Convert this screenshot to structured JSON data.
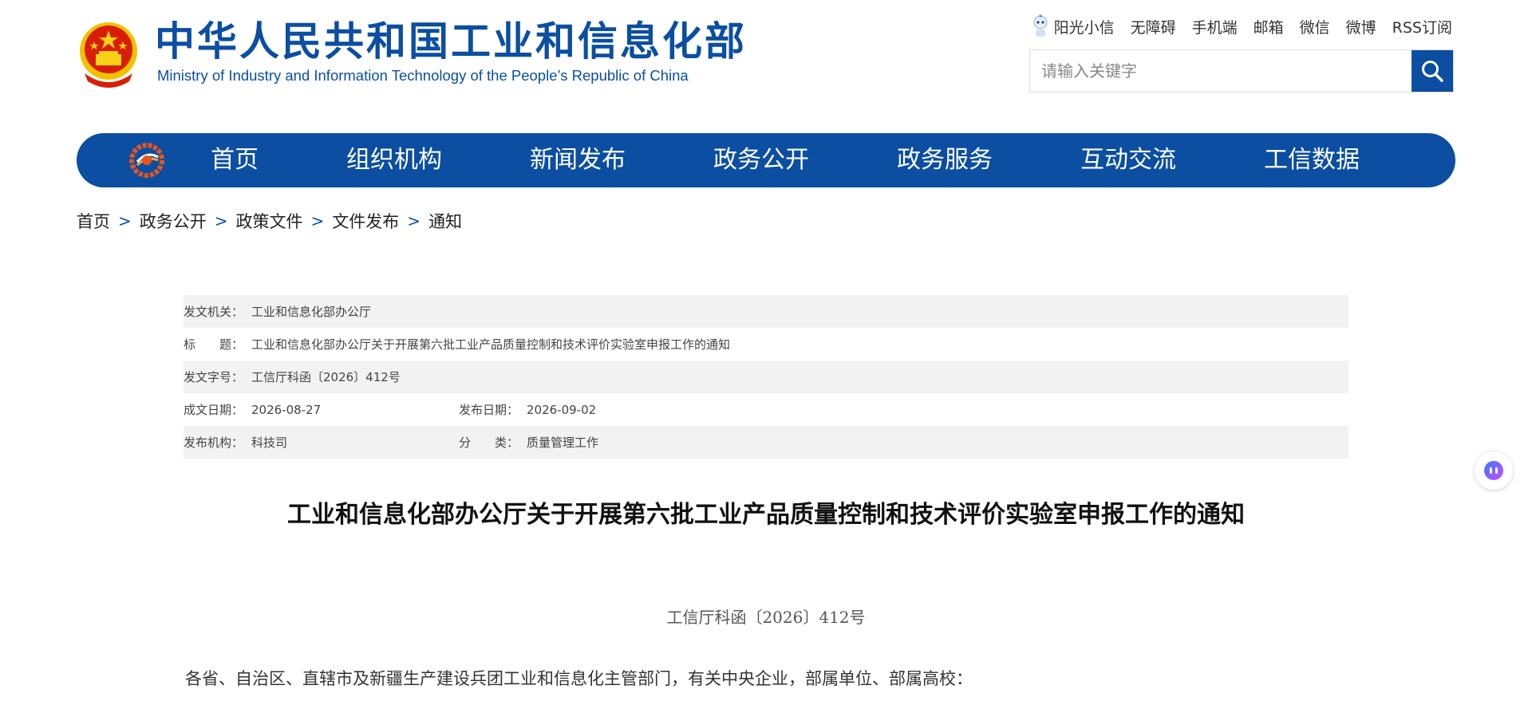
{
  "header": {
    "title_cn": "中华人民共和国工业和信息化部",
    "title_en": "Ministry of Industry and Information Technology of the People’s Republic of China",
    "top_links": [
      "阳光小信",
      "无障碍",
      "手机端",
      "邮箱",
      "微信",
      "微博",
      "RSS订阅"
    ],
    "search_placeholder": "请输入关键字"
  },
  "nav": {
    "items": [
      "首页",
      "组织机构",
      "新闻发布",
      "政务公开",
      "政务服务",
      "互动交流",
      "工信数据"
    ]
  },
  "breadcrumb": [
    "首页",
    "政务公开",
    "政策文件",
    "文件发布",
    "通知"
  ],
  "breadcrumb_sep": ">",
  "meta": {
    "issuer_label": "发文机关：",
    "issuer": "工业和信息化部办公厅",
    "title_label": "标　　题：",
    "title": "工业和信息化部办公厅关于开展第六批工业产品质量控制和技术评价实验室申报工作的通知",
    "doc_no_label": "发文字号：",
    "doc_no": "工信厅科函〔2026〕412号",
    "created_label": "成文日期：",
    "created": "2026-08-27",
    "published_label": "发布日期：",
    "published": "2026-09-02",
    "org_label": "发布机构：",
    "org": "科技司",
    "category_label": "分　　类：",
    "category": "质量管理工作"
  },
  "article": {
    "title": "工业和信息化部办公厅关于开展第六批工业产品质量控制和技术评价实验室申报工作的通知",
    "doc_number": "工信厅科函〔2026〕412号",
    "salutation": "各省、自治区、直辖市及新疆生产建设兵团工业和信息化主管部门，有关中央企业，部属单位、部属高校："
  },
  "colors": {
    "brand_blue": "#0b4ea2",
    "meta_shade": "#f2f2f2"
  }
}
